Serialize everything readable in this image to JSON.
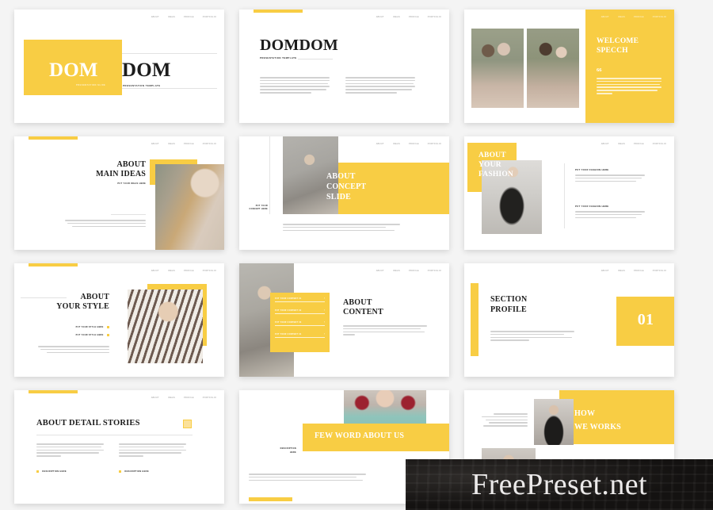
{
  "meta": {
    "background_color": "#f4f4f4",
    "accent_color": "#f8cd44",
    "text_color": "#1c1c1c",
    "slide_count": 12
  },
  "watermark": {
    "text": "FreePreset.net"
  },
  "nav_items": [
    "ABOUT",
    "IDEAS",
    "PROFILE",
    "PORTFOLIO"
  ],
  "slides": [
    {
      "id": "cover",
      "title_yellow": "DOM",
      "title_black": "DOM",
      "sub_yellow": "PRESENTATION SLIDE",
      "sub_black": "PRESENTATION TEMPLATE"
    },
    {
      "id": "intro",
      "title": "DOMDOM",
      "subtitle": "PRESENTATION TEMPLATE",
      "col1_lines": 6,
      "col2_lines": 6
    },
    {
      "id": "welcome-speech",
      "title_line1": "WELCOME",
      "title_line2": "SPECCH",
      "quote_mark": "66",
      "quote_lines": 6,
      "photo1": "two-women-floral-dresses",
      "photo2": "two-women-floral-dresses-closer"
    },
    {
      "id": "about-main-ideas",
      "title_line1": "ABOUT",
      "title_line2": "MAIN IDEAS",
      "caption": "Put your ideas here",
      "body_lines": 3,
      "photo": "woman-redhair-portrait"
    },
    {
      "id": "about-concept-slide",
      "title_line1": "ABOUT",
      "title_line2": "CONCEPT",
      "title_line3": "SLIDE",
      "side_label_line1": "Put your",
      "side_label_line2": "concept here",
      "body_lines": 3,
      "photo": "woman-standing-chair"
    },
    {
      "id": "about-your-fashion",
      "title_line1": "ABOUT",
      "title_line2": "YOUR",
      "title_line3": "FASHION",
      "blocks": [
        {
          "heading": "Put your fashion here",
          "lines": 3
        },
        {
          "heading": "Put your fashion here",
          "lines": 3
        }
      ],
      "photo": "woman-black-gown"
    },
    {
      "id": "about-your-style",
      "title_line1": "ABOUT",
      "title_line2": "YOUR STYLE",
      "captions": [
        "Put your style here",
        "Put your style here"
      ],
      "body_lines": 3,
      "photo": "woman-striped-top"
    },
    {
      "id": "about-content",
      "title_line1": "ABOUT",
      "title_line2": "CONTENT",
      "list_items": [
        "Put your content 01",
        "Put your content 02",
        "Put your content 03",
        "Put your content 04"
      ],
      "body_lines": 4,
      "photo": "woman-sitting-chair"
    },
    {
      "id": "section-profile",
      "title_line1": "SECTION",
      "title_line2": "PROFILE",
      "number": "01",
      "body_lines": 4
    },
    {
      "id": "about-detail-stories",
      "title": "ABOUT DETAIL STORIES",
      "columns": [
        {
          "lines": 5,
          "caption": "Description here"
        },
        {
          "lines": 5,
          "caption": "Description here"
        }
      ]
    },
    {
      "id": "few-word-about-us",
      "title": "FEW WORD ABOUT US",
      "side_label_line1": "Description",
      "side_label_line2": "here",
      "body_lines": 3,
      "photo": "person-teal-hoodie"
    },
    {
      "id": "how-we-works",
      "title_line1": "HOW",
      "title_line2": "WE WORKS",
      "body_lines": 5,
      "photo1": "woman-mask-black-dress",
      "photo2": "woman-mask-lower"
    }
  ]
}
